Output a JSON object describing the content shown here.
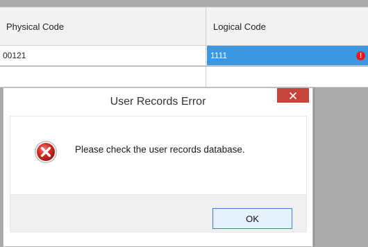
{
  "grid": {
    "columns": [
      "Physical Code",
      "Logical Code"
    ],
    "rows": [
      {
        "physical_code": "00121",
        "logical_code": "1111",
        "error_icon": "!"
      },
      {
        "physical_code": "",
        "logical_code": ""
      }
    ],
    "selected_color": "#3d96e0",
    "error_color": "#e51b1b"
  },
  "dialog": {
    "title": "User Records Error",
    "message": "Please check the user records database.",
    "ok_label": "OK",
    "close_icon": "close-icon",
    "message_icon": "error-icon",
    "close_color": "#c7443c"
  }
}
